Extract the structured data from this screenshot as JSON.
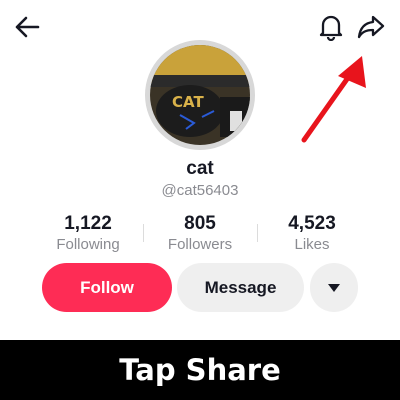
{
  "header": {
    "back_icon": "arrow-left-icon",
    "notification_icon": "bell-icon",
    "share_icon": "share-arrow-icon"
  },
  "profile": {
    "display_name": "cat",
    "username": "@cat56403",
    "avatar_text": "CAT"
  },
  "stats": [
    {
      "value": "1,122",
      "label": "Following"
    },
    {
      "value": "805",
      "label": "Followers"
    },
    {
      "value": "4,523",
      "label": "Likes"
    }
  ],
  "actions": {
    "follow_label": "Follow",
    "message_label": "Message",
    "more_icon": "triangle-down-icon"
  },
  "annotation": {
    "arrow_color": "#e8141c",
    "caption": "Tap Share"
  },
  "colors": {
    "accent": "#fe2c55",
    "secondary_button": "#efefef",
    "muted_text": "#8a8b91"
  }
}
